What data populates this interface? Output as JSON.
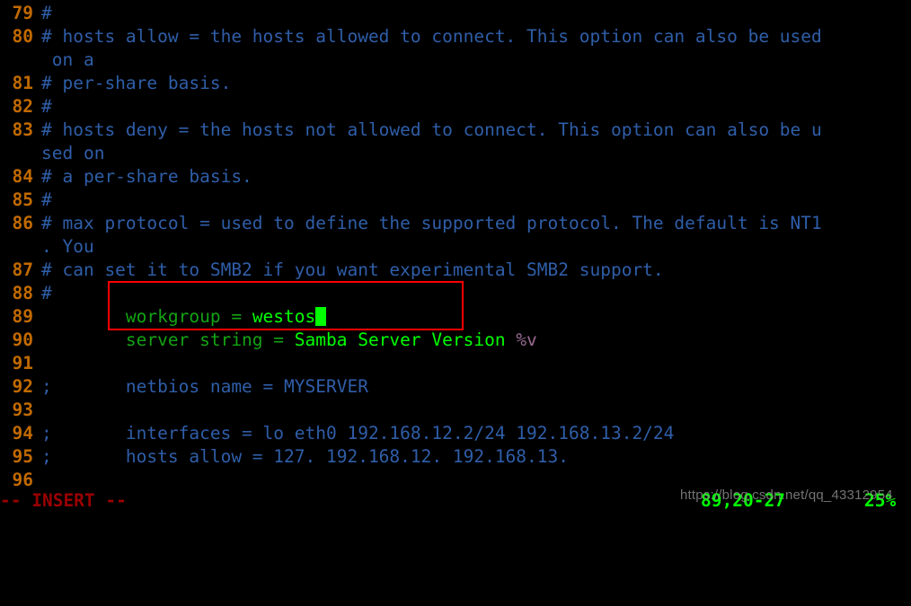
{
  "editor": {
    "app": "vim",
    "font_size_px": 19.5,
    "background": "#000000",
    "colors": {
      "line_number": "#c26a00",
      "comment": "#2f5ea8",
      "directive_key": "#13a313",
      "directive_value": "#00ff00",
      "variable": "#9a6b94",
      "cursor": "#00ff00",
      "mode_text": "#9a0000",
      "ruler_text": "#00ff00",
      "annotation_box": "#ff0000"
    },
    "lines": [
      {
        "number": "79",
        "segments": [
          {
            "text": "#",
            "cls": "c-comment"
          }
        ]
      },
      {
        "number": "80",
        "segments": [
          {
            "text": "# hosts allow = the hosts allowed to connect. This option can also be used",
            "cls": "c-comment"
          }
        ]
      },
      {
        "number": "",
        "segments": [
          {
            "text": " on a",
            "cls": "c-comment"
          }
        ],
        "wrapped": true
      },
      {
        "number": "81",
        "segments": [
          {
            "text": "# per-share basis.",
            "cls": "c-comment"
          }
        ]
      },
      {
        "number": "82",
        "segments": [
          {
            "text": "#",
            "cls": "c-comment"
          }
        ]
      },
      {
        "number": "83",
        "segments": [
          {
            "text": "# hosts deny = the hosts not allowed to connect. This option can also be u",
            "cls": "c-comment"
          }
        ]
      },
      {
        "number": "",
        "segments": [
          {
            "text": "sed on",
            "cls": "c-comment"
          }
        ],
        "wrapped": true
      },
      {
        "number": "84",
        "segments": [
          {
            "text": "# a per-share basis.",
            "cls": "c-comment"
          }
        ]
      },
      {
        "number": "85",
        "segments": [
          {
            "text": "#",
            "cls": "c-comment"
          }
        ]
      },
      {
        "number": "86",
        "segments": [
          {
            "text": "# max protocol = used to define the supported protocol. The default is NT1",
            "cls": "c-comment"
          }
        ]
      },
      {
        "number": "",
        "segments": [
          {
            "text": ". You",
            "cls": "c-comment"
          }
        ],
        "wrapped": true
      },
      {
        "number": "87",
        "segments": [
          {
            "text": "# can set it to SMB2 if you want experimental SMB2 support.",
            "cls": "c-comment"
          }
        ]
      },
      {
        "number": "88",
        "segments": [
          {
            "text": "#",
            "cls": "c-comment"
          }
        ]
      },
      {
        "number": "89",
        "segments": [
          {
            "text": "        workgroup ",
            "cls": "c-key"
          },
          {
            "text": "= ",
            "cls": "c-eq"
          },
          {
            "text": "westos",
            "cls": "c-val"
          }
        ],
        "cursor": true
      },
      {
        "number": "90",
        "segments": [
          {
            "text": "        server string ",
            "cls": "c-key"
          },
          {
            "text": "= ",
            "cls": "c-eq"
          },
          {
            "text": "Samba Server Version ",
            "cls": "c-val"
          },
          {
            "text": "%v",
            "cls": "c-var"
          }
        ]
      },
      {
        "number": "91",
        "segments": [
          {
            "text": "",
            "cls": "c-comment"
          }
        ]
      },
      {
        "number": "92",
        "segments": [
          {
            "text": ";       netbios name = MYSERVER",
            "cls": "c-comment"
          }
        ]
      },
      {
        "number": "93",
        "segments": [
          {
            "text": "",
            "cls": "c-comment"
          }
        ]
      },
      {
        "number": "94",
        "segments": [
          {
            "text": ";       interfaces = lo eth0 192.168.12.2/24 192.168.13.2/24",
            "cls": "c-comment"
          }
        ]
      },
      {
        "number": "95",
        "segments": [
          {
            "text": ";       hosts allow = 127. 192.168.12. 192.168.13.",
            "cls": "c-comment"
          }
        ]
      },
      {
        "number": "96",
        "segments": [
          {
            "text": "",
            "cls": "c-comment"
          }
        ]
      }
    ]
  },
  "statusline": {
    "mode": "-- INSERT --",
    "ruler_position": "89,20-27",
    "ruler_percent": "25%"
  },
  "annotation": {
    "type": "red-rectangle-highlight",
    "target_line": "89",
    "target_text": "workgroup = westos"
  },
  "watermark": {
    "text": "https://blog.csdn.net/qq_43312954"
  }
}
